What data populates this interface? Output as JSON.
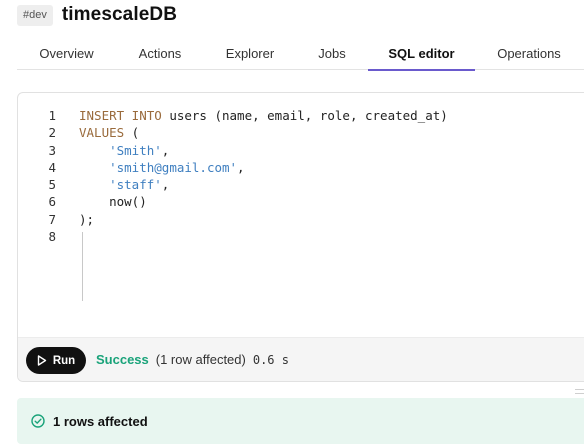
{
  "header": {
    "env_badge": "#dev",
    "db_name": "timescaleDB"
  },
  "tabs": [
    {
      "label": "Overview",
      "active": false
    },
    {
      "label": "Actions",
      "active": false
    },
    {
      "label": "Explorer",
      "active": false
    },
    {
      "label": "Jobs",
      "active": false
    },
    {
      "label": "SQL editor",
      "active": true
    },
    {
      "label": "Operations",
      "active": false
    }
  ],
  "editor": {
    "lines": [
      {
        "number": "1",
        "kw": "INSERT INTO",
        "text": " users (name, email, role, created_at)",
        "str": ""
      },
      {
        "number": "2",
        "kw": "VALUES",
        "text": " (",
        "str": ""
      },
      {
        "number": "3",
        "kw": "",
        "text": "    ",
        "str": "'Smith'",
        "after": ","
      },
      {
        "number": "4",
        "kw": "",
        "text": "    ",
        "str": "'smith@gmail.com'",
        "after": ","
      },
      {
        "number": "5",
        "kw": "",
        "text": "    ",
        "str": "'staff'",
        "after": ","
      },
      {
        "number": "6",
        "kw": "",
        "text": "    now()",
        "str": ""
      },
      {
        "number": "7",
        "kw": "",
        "text": ");",
        "str": ""
      },
      {
        "number": "8",
        "kw": "",
        "text": "",
        "str": ""
      }
    ]
  },
  "run_bar": {
    "run_label": "Run",
    "status": "Success",
    "rows_affected": "(1 row affected)",
    "duration": "0.6 s"
  },
  "result": {
    "message": "1 rows affected"
  },
  "colors": {
    "accent": "#6a5acd",
    "success": "#1aa37a",
    "keyword": "#9a6b3c",
    "string": "#3f7fc0"
  }
}
